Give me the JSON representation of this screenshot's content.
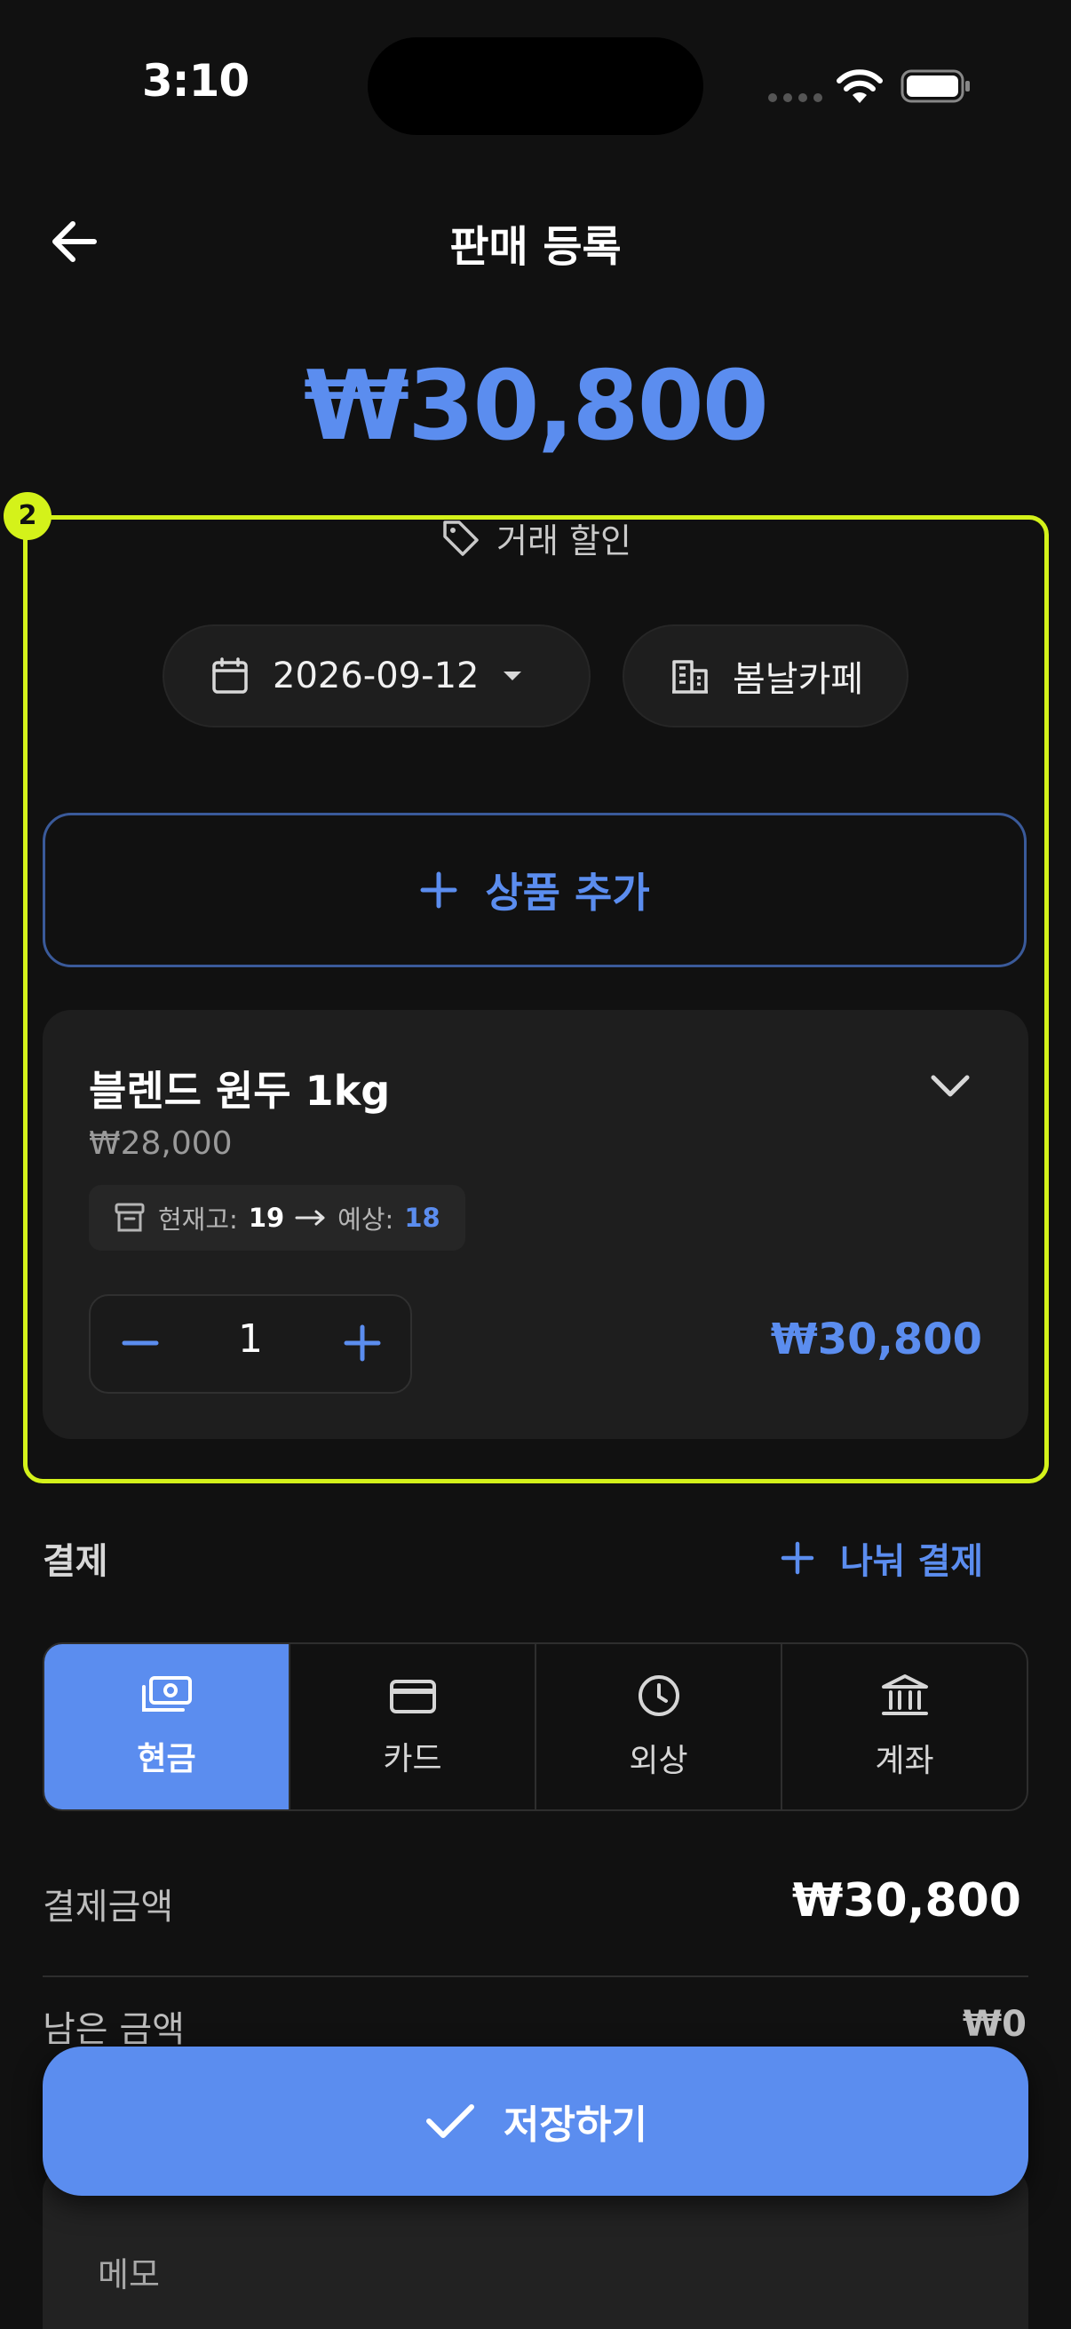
{
  "status_bar": {
    "time": "3:10"
  },
  "header": {
    "title": "판매 등록"
  },
  "summary": {
    "total": "₩30,800"
  },
  "highlight": {
    "badge": "2"
  },
  "discount": {
    "label": "거래 할인"
  },
  "filters": {
    "date": "2026-09-12",
    "store": "봄날카페"
  },
  "add_product": {
    "label": "상품 추가"
  },
  "product": {
    "name": "블렌드 원두 1kg",
    "unit_price": "₩28,000",
    "stock_label": "현재고:",
    "stock_value": "19",
    "expected_label": "예상:",
    "expected_value": "18",
    "quantity": "1",
    "line_total": "₩30,800"
  },
  "payment": {
    "title": "결제",
    "split_label": "나눠 결제",
    "methods": [
      {
        "label": "현금",
        "icon": "cash-icon",
        "active": true
      },
      {
        "label": "카드",
        "icon": "card-icon",
        "active": false
      },
      {
        "label": "외상",
        "icon": "clock-icon",
        "active": false
      },
      {
        "label": "계좌",
        "icon": "bank-icon",
        "active": false
      }
    ],
    "amount_label": "결제금액",
    "amount_value": "₩30,800",
    "remaining_label": "남은 금액",
    "remaining_value": "₩0"
  },
  "memo": {
    "label": "메모"
  },
  "save": {
    "label": "저장하기"
  },
  "colors": {
    "accent": "#5b8def",
    "background": "#111111",
    "highlight": "#d4f21a"
  }
}
